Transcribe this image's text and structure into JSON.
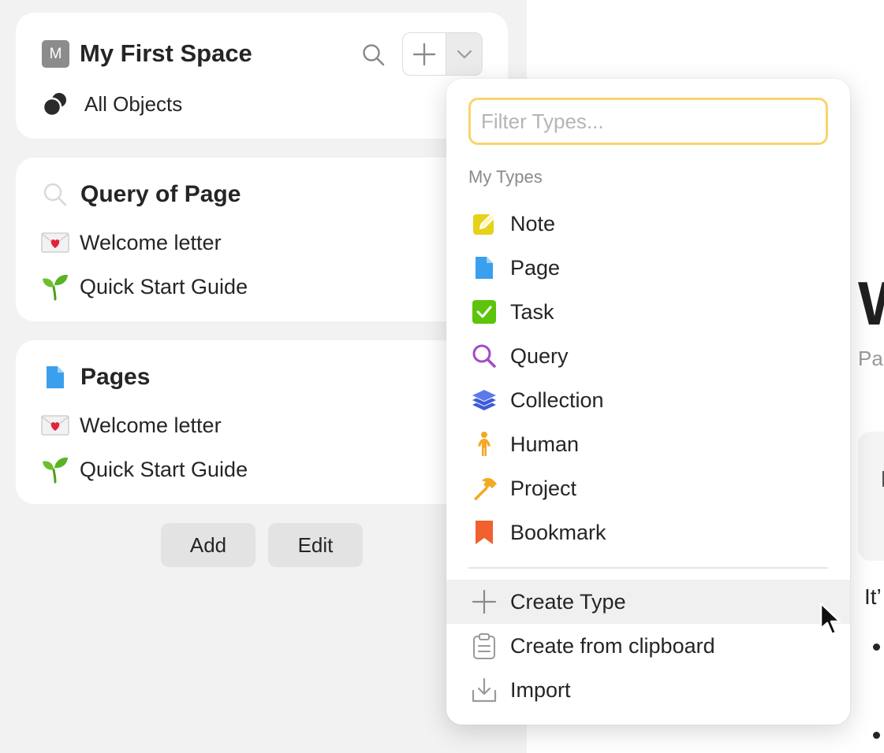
{
  "space": {
    "badge": "M",
    "title": "My First Space",
    "all_objects_label": "All Objects"
  },
  "widgets": [
    {
      "title": "Query of Page",
      "icon": "search-icon",
      "items": [
        {
          "icon": "love-letter-emoji",
          "label": "Welcome letter"
        },
        {
          "icon": "seedling-emoji",
          "label": "Quick Start Guide"
        }
      ]
    },
    {
      "title": "Pages",
      "icon": "page-icon",
      "items": [
        {
          "icon": "love-letter-emoji",
          "label": "Welcome letter"
        },
        {
          "icon": "seedling-emoji",
          "label": "Quick Start Guide"
        }
      ]
    }
  ],
  "sidebar_buttons": {
    "add": "Add",
    "edit": "Edit"
  },
  "dropdown": {
    "filter_placeholder": "Filter Types...",
    "section_label": "My Types",
    "types": [
      {
        "label": "Note",
        "icon": "note-icon",
        "color": "#e6d21a"
      },
      {
        "label": "Page",
        "icon": "page-icon",
        "color": "#3aa0ee"
      },
      {
        "label": "Task",
        "icon": "task-checkbox-icon",
        "color": "#5cc40a"
      },
      {
        "label": "Query",
        "icon": "query-icon",
        "color": "#a448c8"
      },
      {
        "label": "Collection",
        "icon": "collection-layers-icon",
        "color": "#3c5bd6"
      },
      {
        "label": "Human",
        "icon": "human-icon",
        "color": "#f3a923"
      },
      {
        "label": "Project",
        "icon": "hammer-icon",
        "color": "#f3a923"
      },
      {
        "label": "Bookmark",
        "icon": "bookmark-icon",
        "color": "#f0612d"
      }
    ],
    "actions": [
      {
        "label": "Create Type",
        "icon": "plus-icon"
      },
      {
        "label": "Create from clipboard",
        "icon": "clipboard-icon"
      },
      {
        "label": "Import",
        "icon": "import-icon"
      }
    ]
  },
  "document": {
    "title_fragment": "W",
    "subtitle_fragment": "Pa",
    "text_fragment": "It’"
  },
  "colors": {
    "accent_focus": "#f8d56b",
    "sidebar_bg": "#f2f2f2"
  }
}
